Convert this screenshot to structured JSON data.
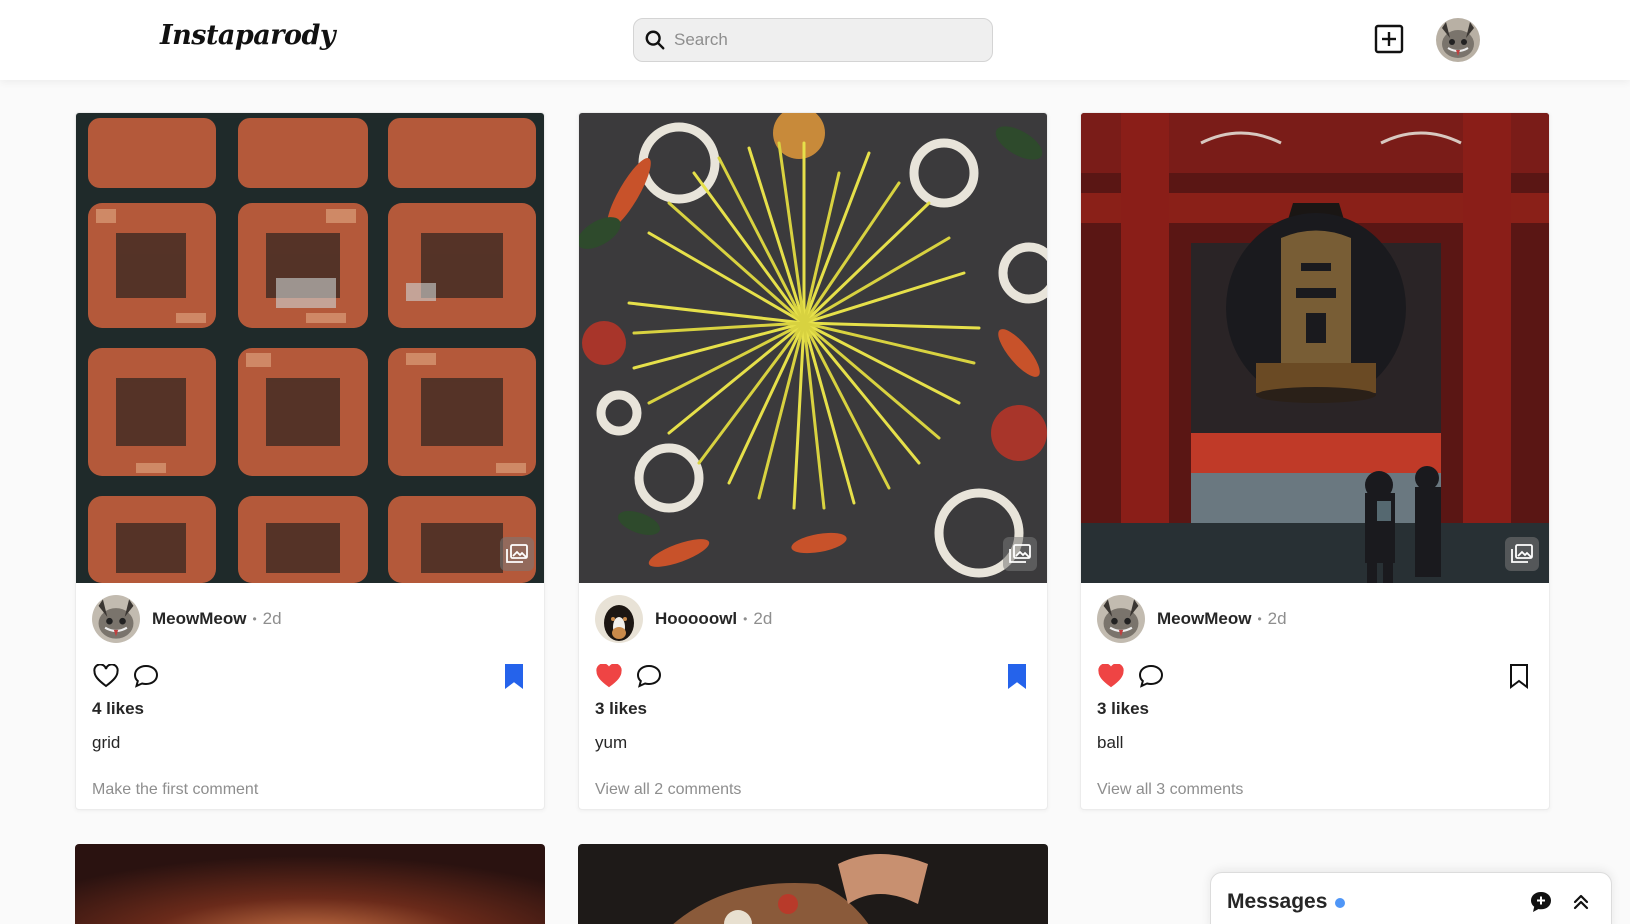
{
  "app": {
    "logo": "Instaparody"
  },
  "search": {
    "placeholder": "Search",
    "value": ""
  },
  "header": {
    "add_icon": "plus-square-icon",
    "avatar": "user-avatar"
  },
  "colors": {
    "accent_blue": "#2563eb",
    "like_red": "#ef4444",
    "text": "#262626",
    "muted": "#8e8e8e",
    "online_dot": "#4f96f7"
  },
  "posts": [
    {
      "author": "MeowMeow",
      "age": "2d",
      "likes": "4 likes",
      "caption": "grid",
      "comments": "Make the first comment",
      "liked": false,
      "saved": true,
      "image": "aerial city grid"
    },
    {
      "author": "Hooooowl",
      "age": "2d",
      "likes": "3 likes",
      "caption": "yum",
      "comments": "View all 2 comments",
      "liked": true,
      "saved": true,
      "image": "spaghetti burst"
    },
    {
      "author": "MeowMeow",
      "age": "2d",
      "likes": "3 likes",
      "caption": "ball",
      "comments": "View all 3 comments",
      "liked": true,
      "saved": false,
      "image": "temple lantern"
    }
  ],
  "messages": {
    "title": "Messages",
    "new_icon": "new-message-icon",
    "expand_icon": "chevrons-up-icon"
  }
}
